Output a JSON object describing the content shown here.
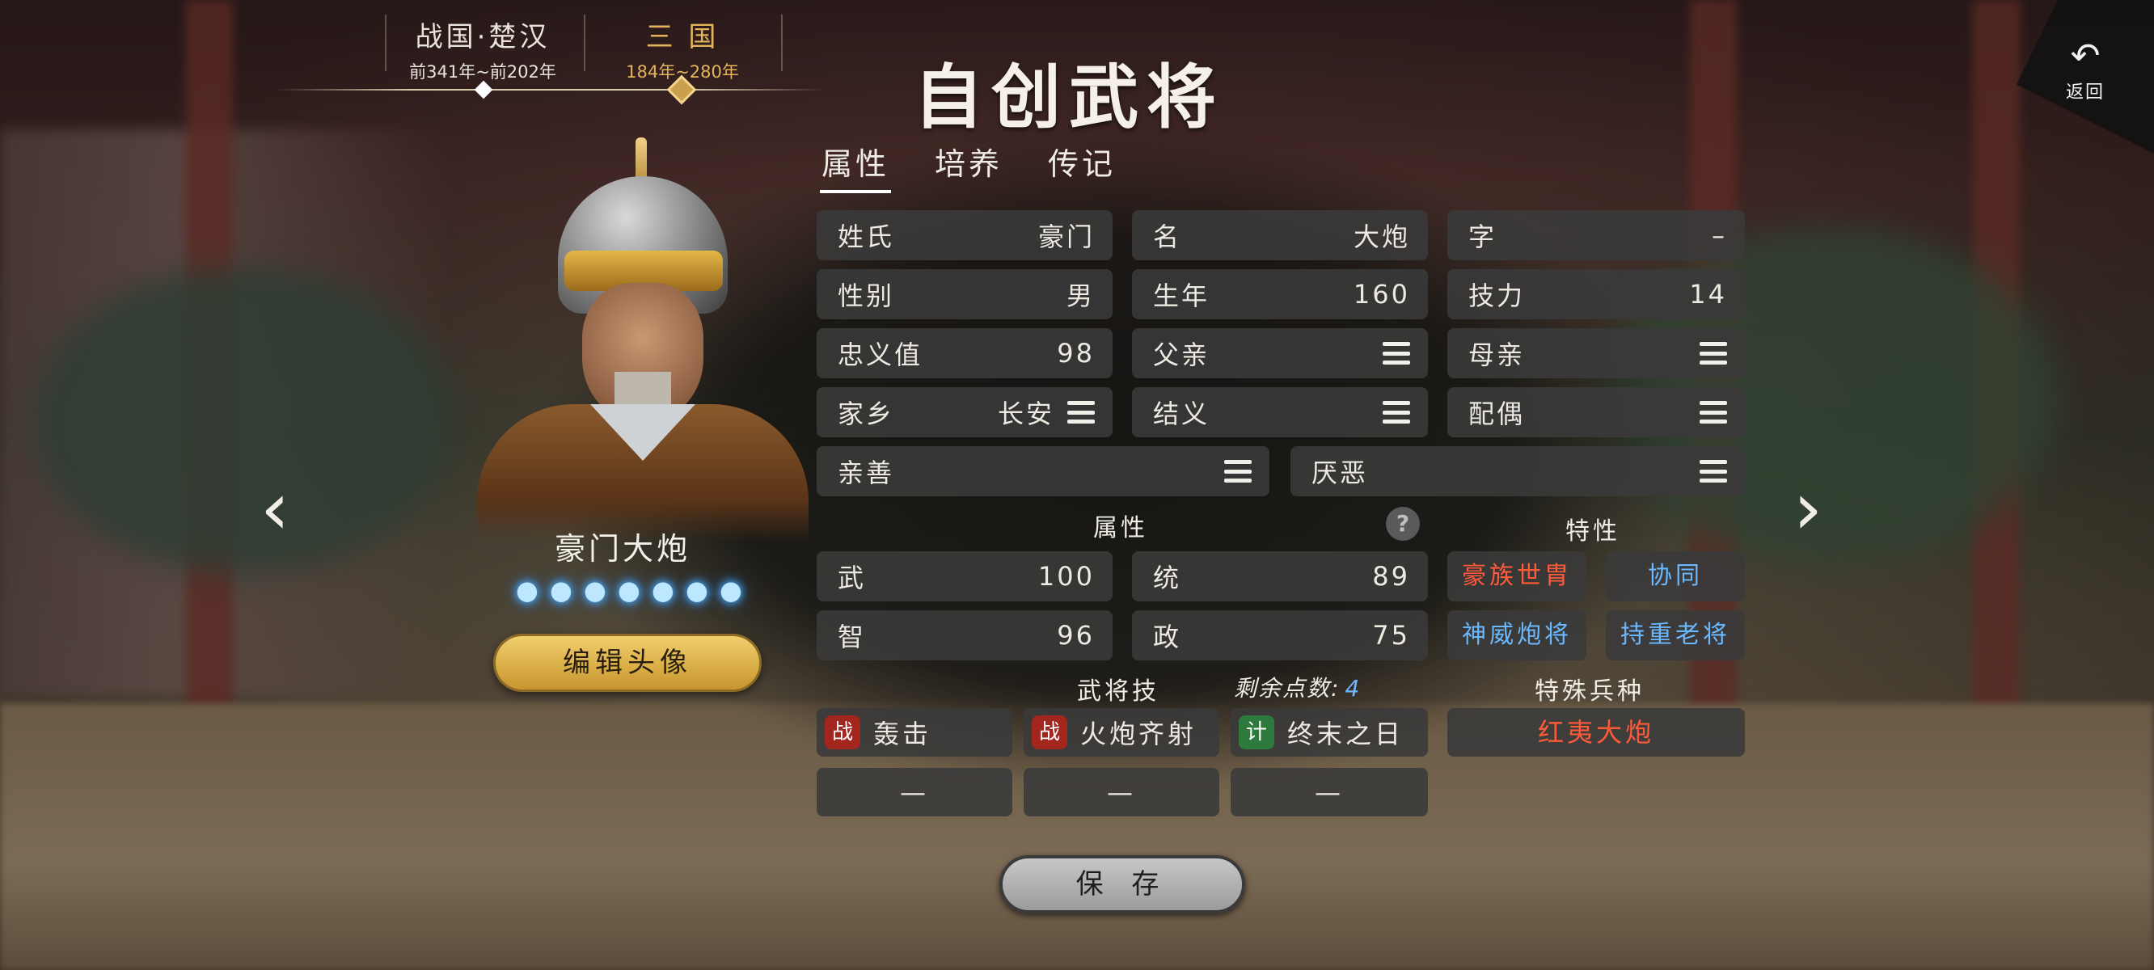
{
  "era": {
    "items": [
      {
        "title": "战国·楚汉",
        "range": "前341年~前202年"
      },
      {
        "title": "三 国",
        "range": "184年~280年"
      }
    ]
  },
  "title": "自创武将",
  "back": {
    "label": "返回",
    "icon": "undo-arrow-icon"
  },
  "hero": {
    "name": "豪门大炮",
    "flame_count": 7,
    "edit_avatar_label": "编辑头像"
  },
  "tabs": [
    "属性",
    "培养",
    "传记"
  ],
  "fields": {
    "surname": {
      "label": "姓氏",
      "value": "豪门"
    },
    "given_name": {
      "label": "名",
      "value": "大炮"
    },
    "style_name": {
      "label": "字",
      "value": "–"
    },
    "gender": {
      "label": "性别",
      "value": "男"
    },
    "birth_year": {
      "label": "生年",
      "value": "160"
    },
    "skill_power": {
      "label": "技力",
      "value": "14"
    },
    "loyalty": {
      "label": "忠义值",
      "value": "98"
    },
    "father": {
      "label": "父亲"
    },
    "mother": {
      "label": "母亲"
    },
    "hometown": {
      "label": "家乡",
      "value": "长安"
    },
    "sworn": {
      "label": "结义"
    },
    "spouse": {
      "label": "配偶"
    },
    "friendly": {
      "label": "亲善"
    },
    "disliked": {
      "label": "厌恶"
    }
  },
  "attributes": {
    "heading": "属性",
    "war": {
      "label": "武",
      "value": "100"
    },
    "command": {
      "label": "统",
      "value": "89"
    },
    "intelligence": {
      "label": "智",
      "value": "96"
    },
    "politics": {
      "label": "政",
      "value": "75"
    }
  },
  "traits": {
    "heading": "特性",
    "items": [
      {
        "label": "豪族世胄",
        "color": "red"
      },
      {
        "label": "协同",
        "color": "blue"
      },
      {
        "label": "神威炮将",
        "color": "blue"
      },
      {
        "label": "持重老将",
        "color": "blue"
      }
    ]
  },
  "skills": {
    "heading": "武将技",
    "remaining_label": "剩余点数:",
    "remaining_value": "4",
    "items": [
      {
        "tag": "战",
        "tag_color": "red",
        "label": "轰击"
      },
      {
        "tag": "战",
        "tag_color": "red",
        "label": "火炮齐射"
      },
      {
        "tag": "计",
        "tag_color": "green",
        "label": "终末之日"
      }
    ],
    "empty_slots": [
      "—",
      "—",
      "—"
    ]
  },
  "special_troop": {
    "heading": "特殊兵种",
    "value": "红夷大炮"
  },
  "save_label": "保 存",
  "colors": {
    "gold": "#e3b45a",
    "trait_red": "#ff5a3a",
    "trait_blue": "#6ab8ff",
    "remaining_blue": "#6fb8ff"
  }
}
